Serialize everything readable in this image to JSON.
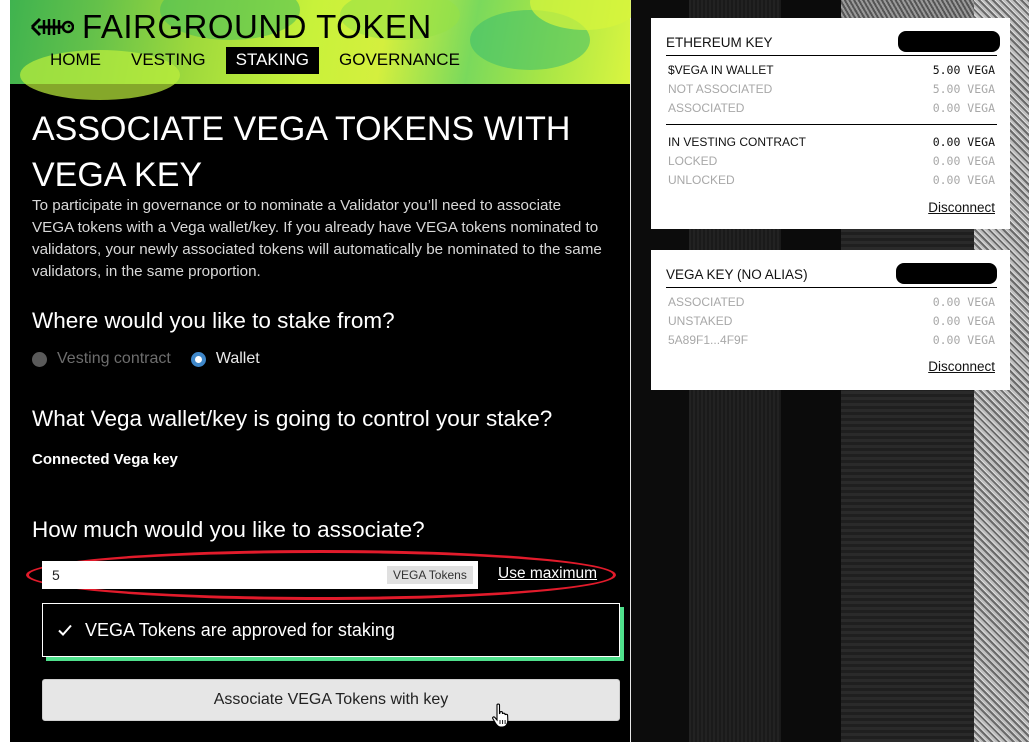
{
  "app": {
    "title": "FAIRGROUND TOKEN",
    "nav": [
      {
        "label": "HOME",
        "active": false
      },
      {
        "label": "VESTING",
        "active": false
      },
      {
        "label": "STAKING",
        "active": true
      },
      {
        "label": "GOVERNANCE",
        "active": false
      }
    ]
  },
  "page": {
    "title": "ASSOCIATE VEGA TOKENS WITH VEGA KEY",
    "intro": "To participate in governance or to nominate a Validator you’ll need to associate VEGA tokens with a Vega wallet/key. If you already have VEGA tokens nominated to validators, your newly associated tokens will automatically be nominated to the same validators, in the same proportion.",
    "stake_from_question": "Where would you like to stake from?",
    "radio_vesting": "Vesting contract",
    "radio_wallet": "Wallet",
    "selected_source": "Wallet",
    "wallet_question": "What Vega wallet/key is going to control your stake?",
    "connected_key_label": "Connected Vega key",
    "amount_question": "How much would you like to associate?",
    "amount_value": "5",
    "amount_suffix": "VEGA Tokens",
    "use_maximum": "Use maximum",
    "approved_message": "VEGA Tokens are approved for staking",
    "associate_button": "Associate VEGA Tokens with key"
  },
  "eth_card": {
    "title": "ETHEREUM KEY",
    "rows_top": [
      {
        "label": "$VEGA IN WALLET",
        "value": "5.00 VEGA",
        "muted": false
      },
      {
        "label": "NOT ASSOCIATED",
        "value": "5.00 VEGA",
        "muted": true
      },
      {
        "label": "ASSOCIATED",
        "value": "0.00 VEGA",
        "muted": true
      }
    ],
    "rows_bottom": [
      {
        "label": "IN VESTING CONTRACT",
        "value": "0.00 VEGA",
        "muted": false
      },
      {
        "label": "LOCKED",
        "value": "0.00 VEGA",
        "muted": true
      },
      {
        "label": "UNLOCKED",
        "value": "0.00 VEGA",
        "muted": true
      }
    ],
    "disconnect": "Disconnect"
  },
  "vega_card": {
    "title": "VEGA KEY (NO ALIAS)",
    "rows": [
      {
        "label": "ASSOCIATED",
        "value": "0.00 VEGA",
        "muted": true
      },
      {
        "label": "UNSTAKED",
        "value": "0.00 VEGA",
        "muted": true
      },
      {
        "label": "5A89F1...4F9F",
        "value": "0.00 VEGA",
        "muted": true
      }
    ],
    "disconnect": "Disconnect"
  },
  "colors": {
    "highlight_ring": "#e21b2b",
    "approved_shadow": "#4fe08c",
    "radio_selected": "#3f87c9"
  }
}
